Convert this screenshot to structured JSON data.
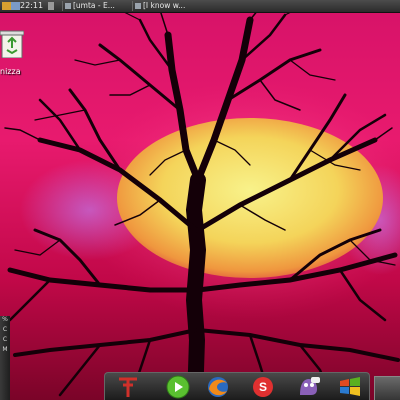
{
  "top_panel": {
    "clock": "22:11",
    "tasks": [
      {
        "label": "[umta - E..."
      },
      {
        "label": "[I know w..."
      }
    ]
  },
  "desktop": {
    "icon_label": "nizza",
    "icon_name": "recycle-bin-icon"
  },
  "side_panel": {
    "items": [
      "%",
      "C",
      "C",
      "M",
      ""
    ]
  },
  "dock": {
    "icons": [
      "tool-icon",
      "media-play-icon",
      "firefox-icon",
      "skype-icon",
      "pidgin-icon",
      "windows-logo-icon",
      "desktop-switcher-icon"
    ]
  },
  "colors": {
    "sky_top": "#e0156b",
    "sky_mid": "#c80a4a",
    "sun_core": "#f5ea7a",
    "sun_edge": "#ee8a3a",
    "tree": "#140008"
  }
}
